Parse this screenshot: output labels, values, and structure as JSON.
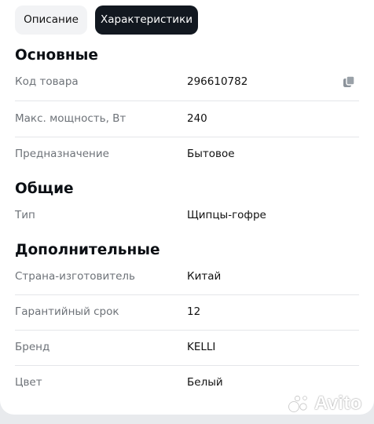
{
  "tabs": [
    {
      "label": "Описание",
      "active": false
    },
    {
      "label": "Характеристики",
      "active": true
    }
  ],
  "sections": {
    "main": {
      "title": "Основные",
      "rows": [
        {
          "label": "Код товара",
          "value": "296610782"
        },
        {
          "label": "Макс. мощность, Вт",
          "value": "240"
        },
        {
          "label": "Предназначение",
          "value": "Бытовое"
        }
      ]
    },
    "general": {
      "title": "Общие",
      "rows": [
        {
          "label": "Тип",
          "value": "Щипцы-гофре"
        }
      ]
    },
    "additional": {
      "title": "Дополнительные",
      "rows": [
        {
          "label": "Страна-изготовитель",
          "value": "Китай"
        },
        {
          "label": "Гарантийный срок",
          "value": "12"
        },
        {
          "label": "Бренд",
          "value": "KELLI"
        },
        {
          "label": "Цвет",
          "value": "Белый"
        }
      ]
    }
  },
  "icons": {
    "copy": "copy-icon"
  },
  "watermark": {
    "text": "Avito"
  },
  "colors": {
    "active_tab_bg": "#121820",
    "inactive_tab_bg": "#f2f3f5",
    "label_text": "#6d7278",
    "divider": "#e4e6e9",
    "page_bg": "#e8eaed"
  }
}
